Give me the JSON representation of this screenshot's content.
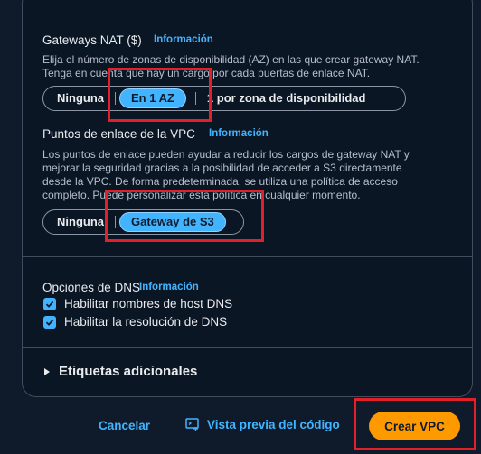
{
  "nat": {
    "label": "Gateways NAT ($)",
    "info": "Información",
    "description_line1": "Elija el número de zonas de disponibilidad (AZ) en las que crear gateway NAT.",
    "description_line2": "Tenga en cuenta que hay un cargo por cada puertas de enlace NAT.",
    "options": [
      "Ninguna",
      "En 1 AZ",
      "1 por zona de disponibilidad"
    ],
    "selected": "En 1 AZ"
  },
  "endpoints": {
    "label": "Puntos de enlace de la VPC",
    "info": "Información",
    "description_lines": [
      "Los puntos de enlace pueden ayudar a reducir los cargos de gateway NAT y",
      "mejorar la seguridad gracias a la posibilidad de acceder a S3 directamente",
      "desde la VPC. De forma predeterminada, se utiliza una política de acceso",
      "completo. Puede personalizar esta política en cualquier momento."
    ],
    "options": [
      "Ninguna",
      "Gateway de S3"
    ],
    "selected": "Gateway de S3"
  },
  "dns": {
    "label": "Opciones de DNS",
    "info": "Información",
    "hostnames_label": "Habilitar nombres de host DNS",
    "hostnames_checked": true,
    "resolution_label": "Habilitar la resolución de DNS",
    "resolution_checked": true
  },
  "tags": {
    "label": "Etiquetas adicionales"
  },
  "footer": {
    "cancel": "Cancelar",
    "preview": "Vista previa del código",
    "create": "Crear VPC"
  },
  "colors": {
    "accent": "#42b4ff",
    "primary_button": "#ff9900",
    "highlight_box": "#e2202a"
  }
}
